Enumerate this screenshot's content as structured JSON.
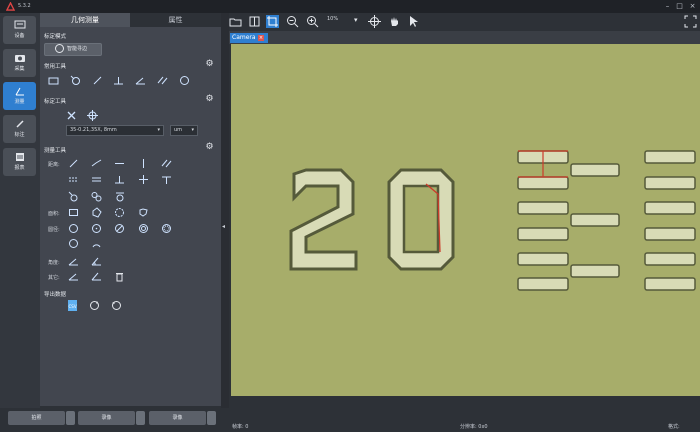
{
  "app": {
    "version": "5.3.2"
  },
  "nav": [
    {
      "label": "设备",
      "icon": "device-icon"
    },
    {
      "label": "采集",
      "icon": "camera-icon"
    },
    {
      "label": "测量",
      "icon": "measure-icon",
      "active": true
    },
    {
      "label": "标注",
      "icon": "pencil-icon"
    },
    {
      "label": "报表",
      "icon": "report-icon"
    }
  ],
  "panel": {
    "tabs": [
      "几何测量",
      "属性"
    ],
    "section_calib_mode": "标定模式",
    "calib_button": "智能寻边",
    "section_common": "常用工具",
    "section_calib": "标定工具",
    "calib_value": "35-0.21,35X, 8mm",
    "unit_value": "um",
    "section_measure": "测量工具",
    "row_labels": [
      "距离:",
      "面积:",
      "圆径:",
      "角度:",
      "其它:"
    ],
    "section_export": "导出数据"
  },
  "toolbar": {
    "zoom": "10%"
  },
  "camera_tab": "Camera",
  "bottom": {
    "btn1": "拍照",
    "btn2": "录像",
    "btn3": "录像"
  },
  "status": {
    "frame_rate": "帧率: 0",
    "resolution": "分辨率: 0x0",
    "format": "格式:"
  },
  "colors": {
    "accent": "#2f7fd0",
    "measure_line": "#cc3b2a",
    "sample_bg": "#a7ad6a"
  }
}
